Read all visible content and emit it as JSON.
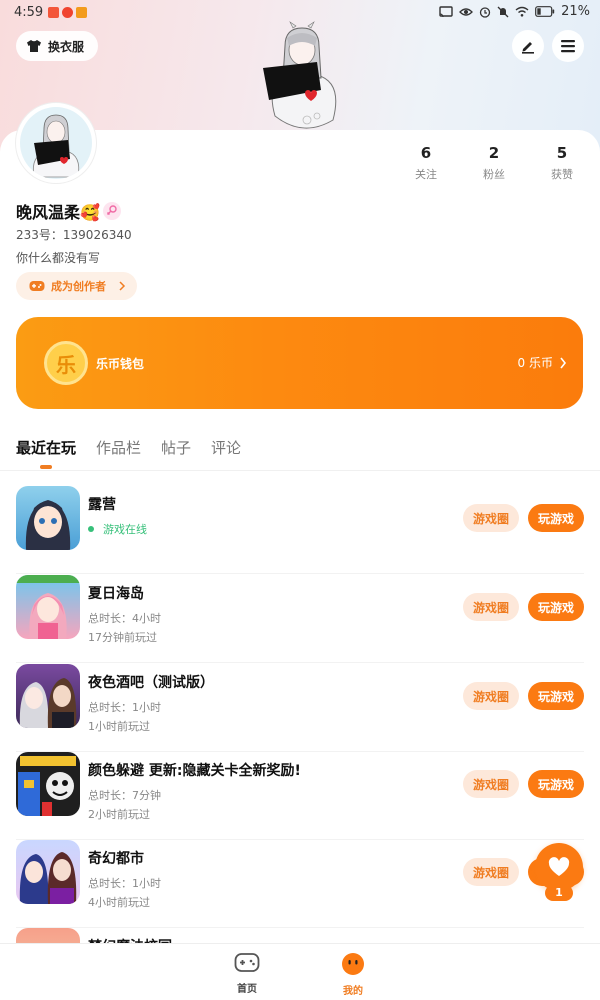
{
  "status_bar": {
    "time": "4:59",
    "battery": "21%"
  },
  "header": {
    "wardrobe_label": "换衣服"
  },
  "profile": {
    "username": "晚风温柔🥰",
    "uid": "233号：139026340",
    "bio": "你什么都没有写",
    "creator_label": "成为创作者",
    "stats": [
      {
        "value": "6",
        "label": "关注"
      },
      {
        "value": "2",
        "label": "粉丝"
      },
      {
        "value": "5",
        "label": "获赞"
      }
    ]
  },
  "wallet": {
    "coin_glyph": "乐",
    "title": "乐币钱包",
    "balance": "0 乐币"
  },
  "tabs": [
    {
      "label": "最近在玩",
      "active": true
    },
    {
      "label": "作品栏",
      "active": false
    },
    {
      "label": "帖子",
      "active": false
    },
    {
      "label": "评论",
      "active": false
    }
  ],
  "games": [
    {
      "name": "露营",
      "line1": "游戏在线",
      "line2": "",
      "online": true,
      "circle_label": "游戏圈",
      "play_label": "玩游戏"
    },
    {
      "name": "夏日海岛",
      "line1": "总时长：4小时",
      "line2": "17分钟前玩过",
      "online": false,
      "circle_label": "游戏圈",
      "play_label": "玩游戏"
    },
    {
      "name": "夜色酒吧（测试版）",
      "line1": "总时长：1小时",
      "line2": "1小时前玩过",
      "online": false,
      "circle_label": "游戏圈",
      "play_label": "玩游戏"
    },
    {
      "name": "颜色躲避 更新:隐藏关卡全新奖励!",
      "line1": "总时长：7分钟",
      "line2": "2小时前玩过",
      "online": false,
      "circle_label": "游戏圈",
      "play_label": "玩游戏"
    },
    {
      "name": "奇幻都市",
      "line1": "总时长：1小时",
      "line2": "4小时前玩过",
      "online": false,
      "circle_label": "游戏圈",
      "play_label": "玩游戏"
    },
    {
      "name": "梦幻魔法校园",
      "line1": "",
      "line2": "",
      "online": false,
      "circle_label": "",
      "play_label": ""
    }
  ],
  "fab": {
    "count": "1"
  },
  "bottom_nav": [
    {
      "label": "首页",
      "active": false
    },
    {
      "label": "我的",
      "active": true
    }
  ],
  "colors": {
    "accent": "#fb7a12",
    "online": "#37c07a"
  }
}
